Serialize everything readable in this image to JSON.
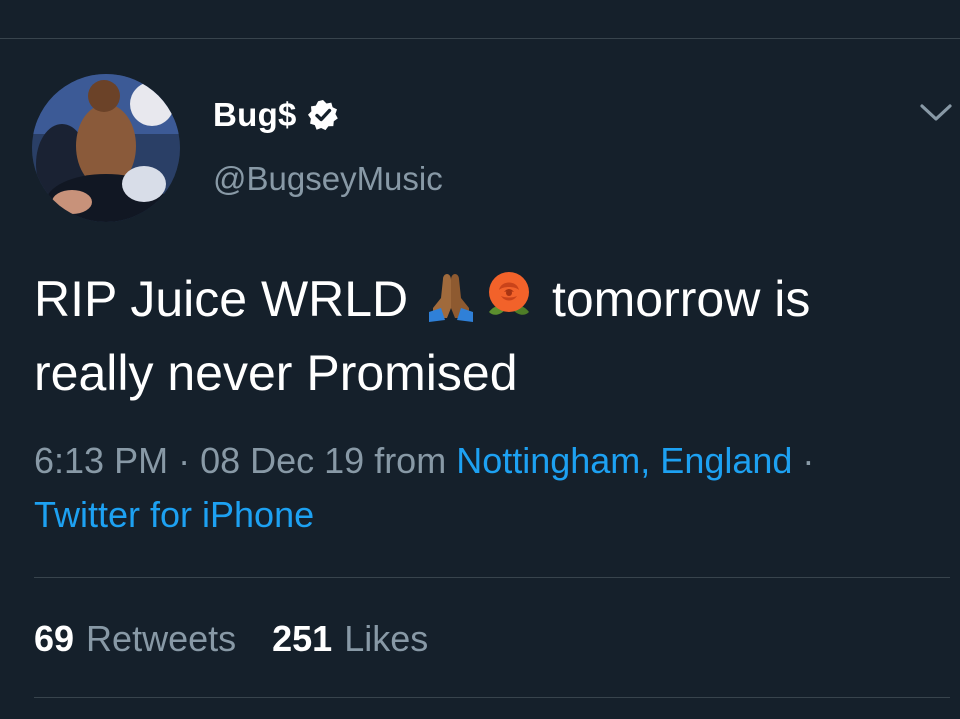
{
  "tweet": {
    "display_name": "Bug$",
    "verified": true,
    "handle": "@BugseyMusic",
    "text_part1": "RIP Juice WRLD ",
    "emojis": [
      "folded-hands-icon",
      "rose-icon"
    ],
    "text_part2": " tomorrow is really never Promised",
    "time": "6:13 PM",
    "separator": " · ",
    "date": "08 Dec 19",
    "from_label": " from ",
    "location": "Nottingham, England",
    "source": "Twitter for iPhone"
  },
  "stats": {
    "retweets_count": "69",
    "retweets_label": "Retweets",
    "likes_count": "251",
    "likes_label": "Likes"
  },
  "colors": {
    "background": "#15202b",
    "divider": "#38444d",
    "secondary_text": "#8899a6",
    "link": "#1da1f2",
    "primary_text": "#ffffff"
  }
}
